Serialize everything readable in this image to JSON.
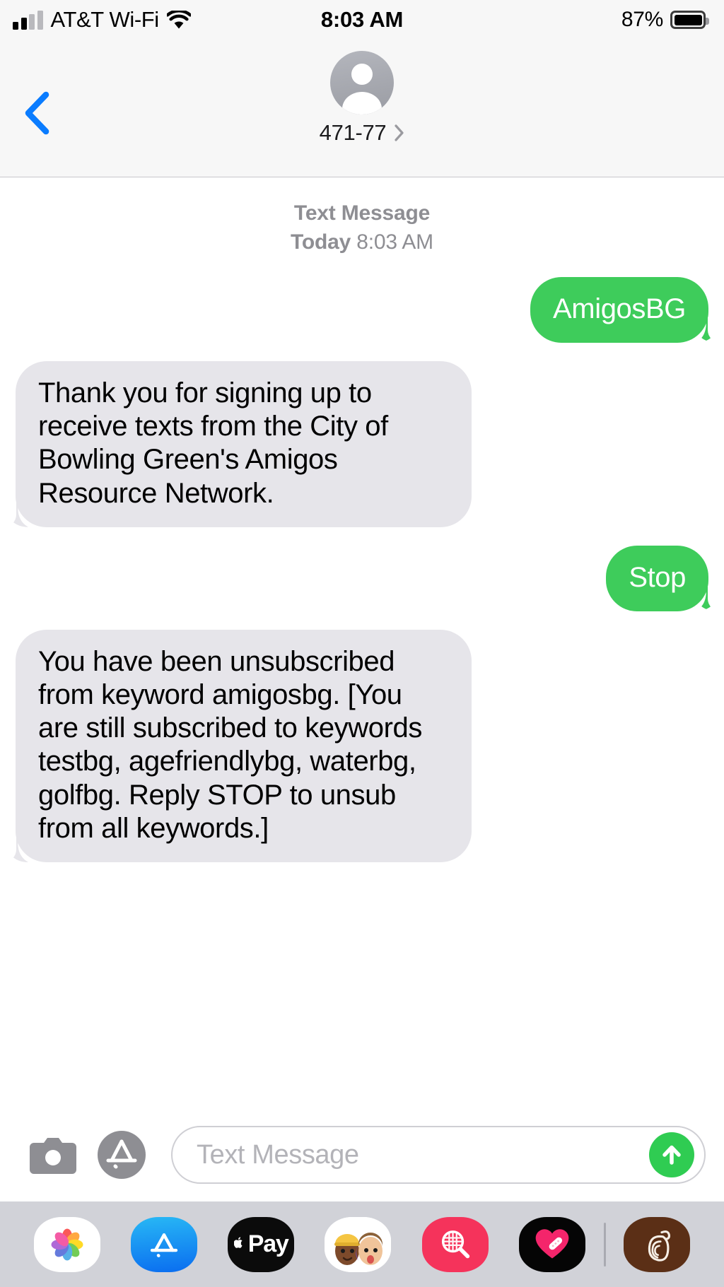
{
  "status_bar": {
    "carrier": "AT&T Wi-Fi",
    "time": "8:03 AM",
    "battery_percent": "87%",
    "signal_bars_filled": 2,
    "signal_bars_total": 4,
    "wifi_icon": "wifi-icon",
    "battery_icon": "battery-icon"
  },
  "nav": {
    "back_icon": "chevron-left-icon",
    "avatar_icon": "person-avatar-icon",
    "contact_name": "471-77",
    "detail_chevron_icon": "chevron-right-icon"
  },
  "thread": {
    "service_label": "Text Message",
    "day_label": "Today",
    "time_label": "8:03 AM",
    "colors": {
      "outgoing_bubble": "#3ecc5b",
      "incoming_bubble": "#e6e5ea",
      "outgoing_text": "#ffffff",
      "incoming_text": "#000000",
      "accent_blue": "#0a7cff",
      "send_green": "#2fcc52"
    },
    "messages": [
      {
        "direction": "outgoing",
        "text": "AmigosBG"
      },
      {
        "direction": "incoming",
        "text": "Thank you for signing up to receive texts from the City of Bowling Green's Amigos Resource Network."
      },
      {
        "direction": "outgoing",
        "text": "Stop"
      },
      {
        "direction": "incoming",
        "text": "You have been unsubscribed from keyword amigosbg. [You are still subscribed to keywords testbg, agefriendlybg, waterbg, golfbg. Reply STOP to unsub from all keywords.]"
      }
    ]
  },
  "input_bar": {
    "camera_icon": "camera-icon",
    "apps_icon": "app-store-icon",
    "placeholder": "Text Message",
    "value": "",
    "send_icon": "send-arrow-up-icon"
  },
  "app_drawer": {
    "apps": [
      {
        "name": "photos-app-icon",
        "label": ""
      },
      {
        "name": "app-store-app-icon",
        "label": ""
      },
      {
        "name": "apple-pay-app-icon",
        "label": "Pay"
      },
      {
        "name": "memoji-app-icon",
        "label": ""
      },
      {
        "name": "image-search-app-icon",
        "label": ""
      },
      {
        "name": "health-heart-app-icon",
        "label": ""
      },
      {
        "name": "pepper-app-icon",
        "label": ""
      }
    ]
  }
}
